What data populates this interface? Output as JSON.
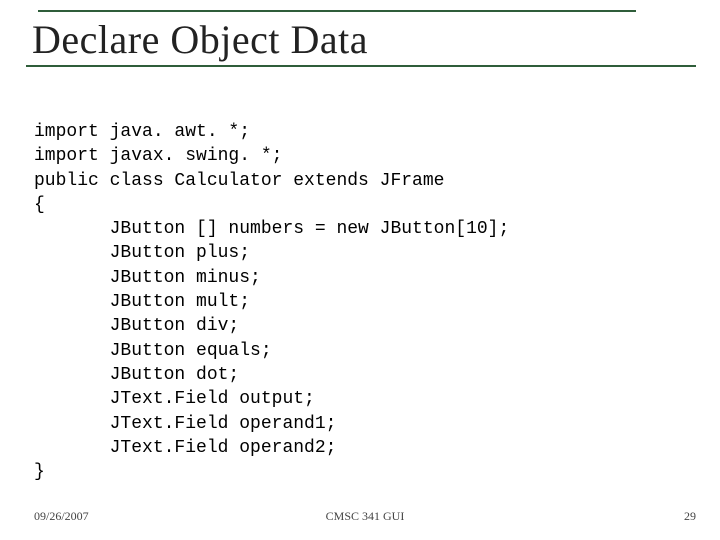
{
  "title": "Declare Object Data",
  "code": {
    "lines": [
      "import java. awt. *;",
      "import javax. swing. *;",
      "public class Calculator extends JFrame",
      "{",
      "       JButton [] numbers = new JButton[10];",
      "       JButton plus;",
      "       JButton minus;",
      "       JButton mult;",
      "       JButton div;",
      "       JButton equals;",
      "       JButton dot;",
      "       JText.Field output;",
      "       JText.Field operand1;",
      "       JText.Field operand2;",
      "}"
    ]
  },
  "footer": {
    "date": "09/26/2007",
    "course": "CMSC 341 GUI",
    "page": "29"
  }
}
